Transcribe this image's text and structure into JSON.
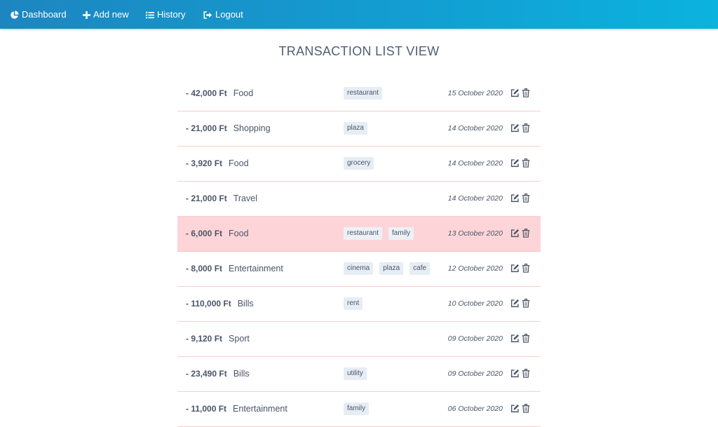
{
  "nav": {
    "dashboard": "Dashboard",
    "add_new": "Add new",
    "history": "History",
    "logout": "Logout"
  },
  "page": {
    "title": "TRANSACTION LIST VIEW"
  },
  "transactions": [
    {
      "amount": "- 42,000 Ft",
      "category": "Food",
      "tags": [
        "restaurant"
      ],
      "date": "15 October 2020",
      "highlighted": false
    },
    {
      "amount": "- 21,000 Ft",
      "category": "Shopping",
      "tags": [
        "plaza"
      ],
      "date": "14 October 2020",
      "highlighted": false
    },
    {
      "amount": "- 3,920 Ft",
      "category": "Food",
      "tags": [
        "grocery"
      ],
      "date": "14 October 2020",
      "highlighted": false
    },
    {
      "amount": "- 21,000 Ft",
      "category": "Travel",
      "tags": [],
      "date": "14 October 2020",
      "highlighted": false
    },
    {
      "amount": "- 6,000 Ft",
      "category": "Food",
      "tags": [
        "restaurant",
        "family"
      ],
      "date": "13 October 2020",
      "highlighted": true
    },
    {
      "amount": "- 8,000 Ft",
      "category": "Entertainment",
      "tags": [
        "cinema",
        "plaza",
        "cafe"
      ],
      "date": "12 October 2020",
      "highlighted": false
    },
    {
      "amount": "- 110,000 Ft",
      "category": "Bills",
      "tags": [
        "rent"
      ],
      "date": "10 October 2020",
      "highlighted": false
    },
    {
      "amount": "- 9,120 Ft",
      "category": "Sport",
      "tags": [],
      "date": "09 October 2020",
      "highlighted": false
    },
    {
      "amount": "- 23,490 Ft",
      "category": "Bills",
      "tags": [
        "utility"
      ],
      "date": "09 October 2020",
      "highlighted": false
    },
    {
      "amount": "- 11,000 Ft",
      "category": "Entertainment",
      "tags": [
        "family"
      ],
      "date": "06 October 2020",
      "highlighted": false
    }
  ],
  "icons": {
    "dashboard": "pie-chart-icon",
    "add_new": "plus-icon",
    "history": "list-icon",
    "logout": "sign-out-icon",
    "edit": "edit-icon",
    "delete": "trash-icon"
  },
  "colors": {
    "navbar_start": "#1d86c1",
    "navbar_end": "#0bb3de",
    "highlight_row": "#fdd5d8",
    "row_border": "#f6cfd2",
    "tag_bg": "#e7edf4",
    "text": "#4a5568"
  }
}
